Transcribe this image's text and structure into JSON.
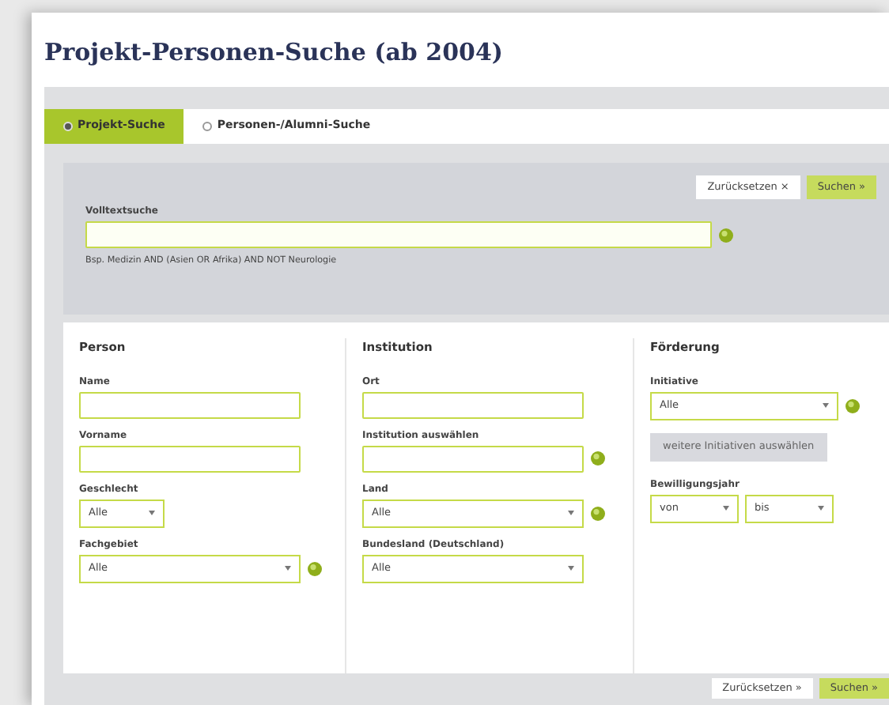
{
  "title": "Projekt-Personen-Suche (ab 2004)",
  "tabs": [
    {
      "label": "Projekt-Suche",
      "selected": true
    },
    {
      "label": "Personen-/Alumni-Suche",
      "selected": false
    }
  ],
  "top_buttons": [
    {
      "label": "Zurücksetzen ×",
      "kind": "reset"
    },
    {
      "label": "Suchen »",
      "kind": "submit"
    }
  ],
  "fulltext": {
    "label": "Volltextsuche",
    "help": true,
    "hint": "Bsp. Medizin AND (Asien OR Afrika) AND NOT Neurologie"
  },
  "columns": [
    {
      "heading": "Person",
      "fields": [
        {
          "kind": "text",
          "label": "Name",
          "help": false
        },
        {
          "kind": "text",
          "label": "Vorname",
          "help": false
        },
        {
          "kind": "short-select",
          "label": "Geschlecht",
          "value": "Alle",
          "help": false
        },
        {
          "kind": "select",
          "label": "Fachgebiet",
          "value": "Alle",
          "help": true
        }
      ]
    },
    {
      "heading": "Institution",
      "fields": [
        {
          "kind": "text",
          "label": "Ort",
          "help": false
        },
        {
          "kind": "text",
          "label": "Institution auswählen",
          "help": true
        },
        {
          "kind": "select",
          "label": "Land",
          "value": "Alle",
          "help": true
        },
        {
          "kind": "select",
          "label": "Bundesland (Deutschland)",
          "value": "Alle",
          "help": false
        }
      ]
    },
    {
      "heading": "Förderung",
      "fields": [
        {
          "kind": "select",
          "label": "Initiative",
          "value": "Alle",
          "help": true
        },
        {
          "kind": "button",
          "label": "weitere Initiativen auswählen"
        },
        {
          "kind": "range",
          "label": "Bewilligungsjahr",
          "values": [
            "von",
            "bis"
          ]
        }
      ]
    }
  ],
  "bottom_buttons": [
    {
      "label": "Zurücksetzen »",
      "kind": "reset"
    },
    {
      "label": "Suchen »",
      "kind": "submit"
    }
  ]
}
